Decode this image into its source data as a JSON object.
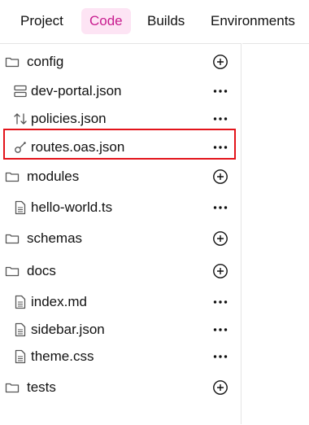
{
  "tabs": [
    {
      "label": "Project",
      "active": false
    },
    {
      "label": "Code",
      "active": true
    },
    {
      "label": "Builds",
      "active": false
    },
    {
      "label": "Environments",
      "active": false
    }
  ],
  "tree": {
    "config": "config",
    "dev_portal": "dev-portal.json",
    "policies": "policies.json",
    "routes": "routes.oas.json",
    "modules": "modules",
    "hello_world": "hello-world.ts",
    "schemas": "schemas",
    "docs": "docs",
    "index": "index.md",
    "sidebar": "sidebar.json",
    "theme": "theme.css",
    "tests": "tests"
  },
  "colors": {
    "active_tab_bg": "#fde4f4",
    "active_tab_text": "#c81c8f",
    "highlight": "#e3141b"
  }
}
